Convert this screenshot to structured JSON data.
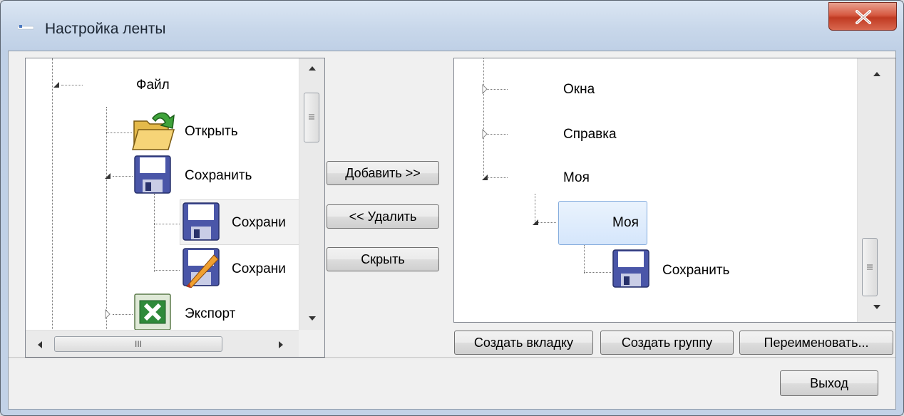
{
  "window": {
    "title": "Настройка ленты"
  },
  "left_tree": {
    "items": [
      {
        "label": "Файл",
        "icon": "none",
        "expander": "expanded"
      },
      {
        "label": "Открыть",
        "icon": "folder-open-icon"
      },
      {
        "label": "Сохранить",
        "icon": "floppy-disk-icon",
        "expander": "expanded"
      },
      {
        "label": "Сохрани",
        "icon": "floppy-disk-icon"
      },
      {
        "label": "Сохрани",
        "icon": "floppy-disk-pencil-icon"
      },
      {
        "label": "Экспорт",
        "icon": "excel-icon",
        "expander": "collapsed"
      }
    ],
    "hscroll_grip": "III"
  },
  "middle_buttons": {
    "add": "Добавить >>",
    "remove": "<< Удалить",
    "hide": "Скрыть"
  },
  "right_tree": {
    "items": [
      {
        "label": "Окна",
        "expander": "collapsed"
      },
      {
        "label": "Справка",
        "expander": "collapsed"
      },
      {
        "label": "Моя",
        "expander": "expanded"
      },
      {
        "label": "Моя",
        "expander": "expanded",
        "selected": true
      },
      {
        "label": "Сохранить",
        "icon": "floppy-disk-icon"
      }
    ]
  },
  "right_buttons": {
    "create_tab": "Создать вкладку",
    "create_group": "Создать группу",
    "rename": "Переименовать..."
  },
  "footer": {
    "exit": "Выход"
  },
  "colors": {
    "close_button": "#c8452d",
    "selection": "#d5e6fb",
    "floppy": "#4a56a8"
  }
}
